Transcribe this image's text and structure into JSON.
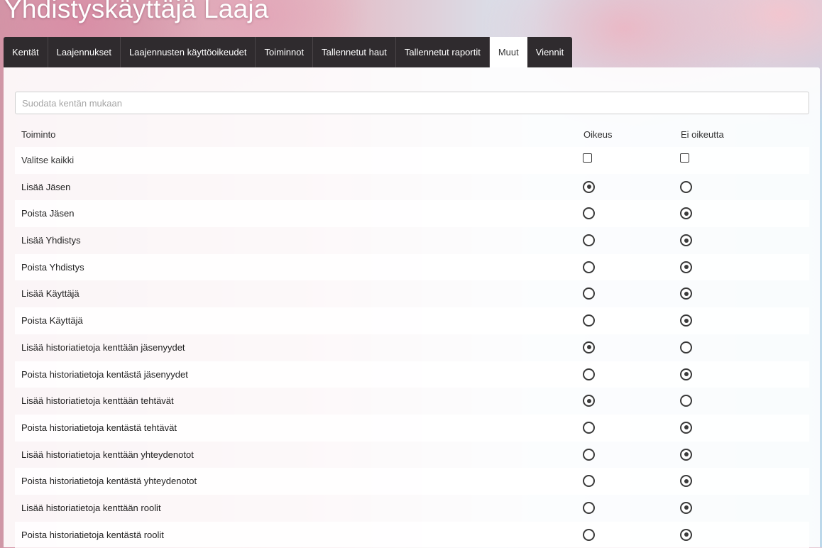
{
  "app": {
    "title": "Yhdistyskäyttäjä Laaja"
  },
  "tabs": [
    {
      "label": "Kentät",
      "active": false
    },
    {
      "label": "Laajennukset",
      "active": false
    },
    {
      "label": "Laajennusten käyttöoikeudet",
      "active": false
    },
    {
      "label": "Toiminnot",
      "active": false
    },
    {
      "label": "Tallennetut haut",
      "active": false
    },
    {
      "label": "Tallennetut raportit",
      "active": false
    },
    {
      "label": "Muut",
      "active": true
    },
    {
      "label": "Viennit",
      "active": false
    }
  ],
  "filter": {
    "placeholder": "Suodata kentän mukaan",
    "value": ""
  },
  "table": {
    "headers": {
      "action": "Toiminto",
      "allowed": "Oikeus",
      "denied": "Ei oikeutta"
    },
    "select_all": {
      "label": "Valitse kaikki",
      "allowed_checked": false,
      "denied_checked": false
    },
    "rows": [
      {
        "label": "Lisää Jäsen",
        "value": "allowed"
      },
      {
        "label": "Poista Jäsen",
        "value": "denied"
      },
      {
        "label": "Lisää Yhdistys",
        "value": "denied"
      },
      {
        "label": "Poista Yhdistys",
        "value": "denied"
      },
      {
        "label": "Lisää Käyttäjä",
        "value": "denied"
      },
      {
        "label": "Poista Käyttäjä",
        "value": "denied"
      },
      {
        "label": "Lisää historiatietoja kenttään jäsenyydet",
        "value": "allowed"
      },
      {
        "label": "Poista historiatietoja kentästä jäsenyydet",
        "value": "denied"
      },
      {
        "label": "Lisää historiatietoja kenttään tehtävät",
        "value": "allowed"
      },
      {
        "label": "Poista historiatietoja kentästä tehtävät",
        "value": "denied"
      },
      {
        "label": "Lisää historiatietoja kenttään yhteydenotot",
        "value": "denied"
      },
      {
        "label": "Poista historiatietoja kentästä yhteydenotot",
        "value": "denied"
      },
      {
        "label": "Lisää historiatietoja kenttään roolit",
        "value": "denied"
      },
      {
        "label": "Poista historiatietoja kentästä roolit",
        "value": "denied"
      }
    ]
  }
}
